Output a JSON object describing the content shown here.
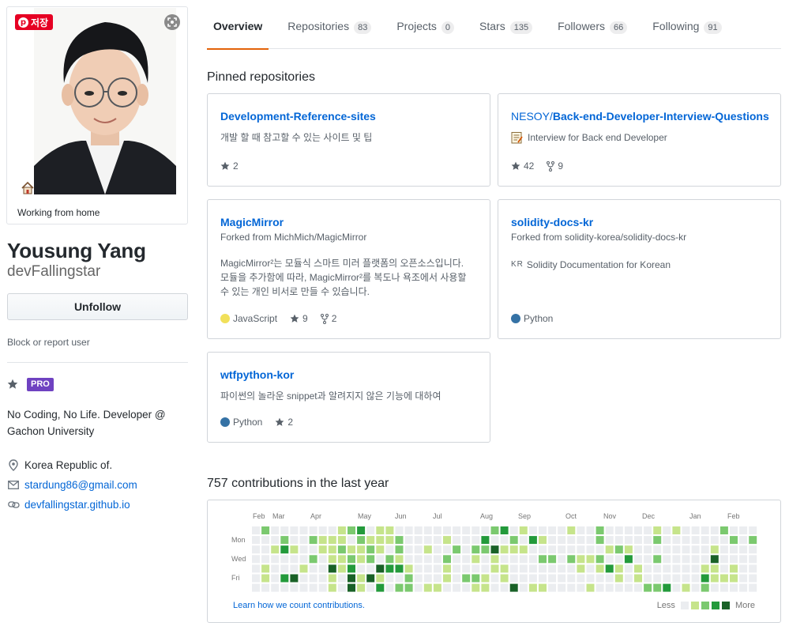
{
  "profile": {
    "save_badge": "저장",
    "status": "Working from home",
    "full_name": "Yousung Yang",
    "username": "devFallingstar",
    "unfollow_label": "Unfollow",
    "block_label": "Block or report user",
    "pro_label": "PRO",
    "bio": "No Coding, No Life. Developer @ Gachon University",
    "location": "Korea Republic of.",
    "email": "stardung86@gmail.com",
    "website": "devfallingstar.github.io"
  },
  "tabs": [
    {
      "label": "Overview",
      "count": null
    },
    {
      "label": "Repositories",
      "count": "83"
    },
    {
      "label": "Projects",
      "count": "0"
    },
    {
      "label": "Stars",
      "count": "135"
    },
    {
      "label": "Followers",
      "count": "66"
    },
    {
      "label": "Following",
      "count": "91"
    }
  ],
  "pinned": {
    "title": "Pinned repositories",
    "repos": [
      {
        "owner": "",
        "name": "Development-Reference-sites",
        "fork": "",
        "emoji": "",
        "description": "개발 할 때 참고할 수 있는 사이트 및 팁",
        "language": "",
        "stars": "2",
        "forks": ""
      },
      {
        "owner": "NESOY/",
        "name": "Back-end-Developer-Interview-Questions",
        "fork": "",
        "emoji": "📝",
        "description": "Interview for Back end Developer",
        "language": "",
        "stars": "42",
        "forks": "9"
      },
      {
        "owner": "",
        "name": "MagicMirror",
        "fork": "Forked from MichMich/MagicMirror",
        "emoji": "",
        "description": "MagicMirror²는 모듈식 스마트 미러 플랫폼의 오픈소스입니다. 모듈을 추가함에 따라, MagicMirror²를 복도나 욕조에서 사용할 수 있는 개인 비서로 만들 수 있습니다.",
        "language": "JavaScript",
        "stars": "9",
        "forks": "2"
      },
      {
        "owner": "",
        "name": "solidity-docs-kr",
        "fork": "Forked from solidity-korea/solidity-docs-kr",
        "emoji": "KR",
        "description": "Solidity Documentation for Korean",
        "language": "Python",
        "stars": "",
        "forks": ""
      },
      {
        "owner": "",
        "name": "wtfpython-kor",
        "fork": "",
        "emoji": "",
        "description": "파이썬의 놀라운 snippet과 알려지지 않은 기능에 대하여",
        "language": "Python",
        "stars": "2",
        "forks": ""
      }
    ]
  },
  "languages": {
    "JavaScript": "#f1e05a",
    "Python": "#3572A5"
  },
  "contributions": {
    "title": "757 contributions in the last year",
    "months": [
      "Feb",
      "Mar",
      "Apr",
      "May",
      "Jun",
      "Jul",
      "Aug",
      "Sep",
      "Oct",
      "Nov",
      "Dec",
      "Jan",
      "Feb"
    ],
    "days": [
      "Mon",
      "Wed",
      "Fri"
    ],
    "learn_link": "Learn how we count contributions.",
    "legend_less": "Less",
    "legend_more": "More",
    "colors": [
      "#ebedf0",
      "#c6e48b",
      "#7bc96f",
      "#239a3b",
      "#196127"
    ]
  }
}
